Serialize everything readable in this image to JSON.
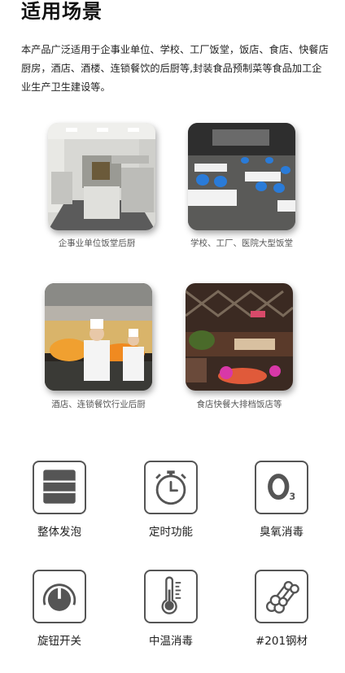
{
  "section": {
    "title": "适用场景",
    "description": "本产品广泛适用于企事业单位、学校、工厂饭堂，饭店、食店、快餐店厨房，酒店、酒楼、连锁餐饮的后厨等,封装食品预制菜等食品加工企业生产卫生建设等。"
  },
  "scenarios": [
    {
      "caption": "企事业单位饭堂后厨",
      "icon": "commercial-kitchen-photo"
    },
    {
      "caption": "学校、工厂、医院大型饭堂",
      "icon": "canteen-photo"
    },
    {
      "caption": "酒店、连锁餐饮行业后厨",
      "icon": "chefs-cooking-photo"
    },
    {
      "caption": "食店快餐大排档饭店等",
      "icon": "night-food-stall-photo"
    }
  ],
  "features": [
    {
      "label": "整体发泡",
      "icon": "foam-layers-icon"
    },
    {
      "label": "定时功能",
      "icon": "stopwatch-icon"
    },
    {
      "label": "臭氧消毒",
      "icon": "ozone-icon"
    },
    {
      "label": "旋钮开关",
      "icon": "knob-icon"
    },
    {
      "label": "中温消毒",
      "icon": "thermometer-icon"
    },
    {
      "label": "#201钢材",
      "icon": "steel-pipes-icon"
    }
  ],
  "colors": {
    "icon_stroke": "#555555",
    "text": "#222222",
    "caption": "#555555"
  }
}
